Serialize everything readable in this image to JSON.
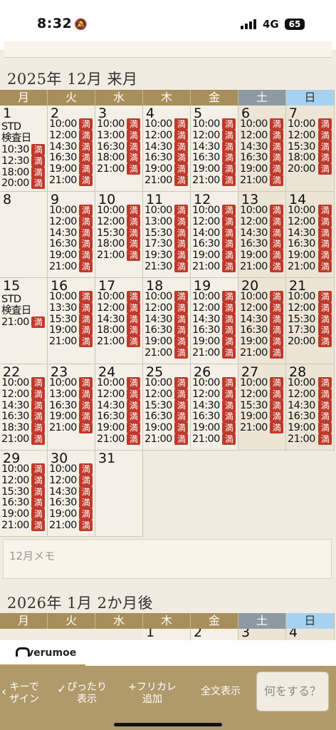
{
  "status": {
    "time": "8:32",
    "network": "4G",
    "battery": "65"
  },
  "dow": [
    "月",
    "火",
    "水",
    "木",
    "金",
    "土",
    "日"
  ],
  "december": {
    "title": "2025年 12月 来月",
    "full_mark": "満",
    "weeks": [
      [
        {
          "day": "1",
          "notes": [
            "STD",
            "検査日"
          ],
          "slots": [
            "10:30",
            "12:30",
            "18:00",
            "20:00"
          ]
        },
        {
          "day": "2",
          "slots": [
            "10:00",
            "12:00",
            "14:30",
            "16:30",
            "19:00",
            "21:00"
          ]
        },
        {
          "day": "3",
          "slots": [
            "10:00",
            "13:00",
            "16:30",
            "18:00",
            "21:00"
          ]
        },
        {
          "day": "4",
          "slots": [
            "10:00",
            "12:00",
            "14:30",
            "16:30",
            "19:00",
            "21:00"
          ]
        },
        {
          "day": "5",
          "slots": [
            "10:00",
            "12:00",
            "14:30",
            "16:30",
            "19:00",
            "21:00"
          ]
        },
        {
          "day": "6",
          "slots": [
            "10:00",
            "12:00",
            "14:30",
            "16:30",
            "19:00",
            "21:00"
          ]
        },
        {
          "day": "7",
          "slots": [
            "10:00",
            "12:00",
            "15:30",
            "18:00",
            "20:00"
          ]
        }
      ],
      [
        {
          "day": "8",
          "slots": []
        },
        {
          "day": "9",
          "slots": [
            "10:00",
            "12:00",
            "14:30",
            "16:30",
            "19:00",
            "21:00"
          ]
        },
        {
          "day": "10",
          "slots": [
            "10:00",
            "12:00",
            "15:30",
            "18:00",
            "21:00"
          ]
        },
        {
          "day": "11",
          "slots": [
            "10:00",
            "13:00",
            "15:30",
            "17:30",
            "19:30",
            "21:30"
          ]
        },
        {
          "day": "12",
          "slots": [
            "10:00",
            "12:00",
            "14:00",
            "16:30",
            "19:00",
            "21:00"
          ]
        },
        {
          "day": "13",
          "slots": [
            "10:00",
            "12:00",
            "14:30",
            "16:30",
            "19:00",
            "21:00"
          ]
        },
        {
          "day": "14",
          "slots": [
            "10:00",
            "12:00",
            "14:30",
            "16:30",
            "19:00",
            "21:00"
          ]
        }
      ],
      [
        {
          "day": "15",
          "notes": [
            "STD",
            "検査日"
          ],
          "slots": [
            "21:00"
          ]
        },
        {
          "day": "16",
          "slots": [
            "10:00",
            "13:30",
            "15:30",
            "19:00",
            "21:00"
          ]
        },
        {
          "day": "17",
          "slots": [
            "10:00",
            "12:00",
            "14:30",
            "18:00",
            "21:00"
          ]
        },
        {
          "day": "18",
          "slots": [
            "10:00",
            "12:00",
            "14:30",
            "16:30",
            "19:00",
            "21:00"
          ]
        },
        {
          "day": "19",
          "slots": [
            "10:00",
            "12:00",
            "14:30",
            "16:30",
            "19:00",
            "21:00"
          ]
        },
        {
          "day": "20",
          "slots": [
            "10:00",
            "12:00",
            "14:30",
            "16:30",
            "19:00",
            "21:00"
          ]
        },
        {
          "day": "21",
          "slots": [
            "10:00",
            "12:00",
            "15:30",
            "17:30",
            "20:00"
          ]
        }
      ],
      [
        {
          "day": "22",
          "slots": [
            "10:00",
            "12:00",
            "14:30",
            "16:30",
            "18:30",
            "21:00"
          ]
        },
        {
          "day": "23",
          "slots": [
            "10:00",
            "13:00",
            "16:30",
            "19:00",
            "21:00"
          ]
        },
        {
          "day": "24",
          "slots": [
            "10:00",
            "12:00",
            "14:30",
            "16:30",
            "19:00",
            "21:00"
          ]
        },
        {
          "day": "25",
          "slots": [
            "10:00",
            "12:00",
            "15:30",
            "16:30",
            "19:00",
            "21:00"
          ]
        },
        {
          "day": "26",
          "slots": [
            "10:00",
            "12:00",
            "14:30",
            "16:30",
            "19:00",
            "21:00"
          ]
        },
        {
          "day": "27",
          "slots": [
            "10:00",
            "12:00",
            "15:30",
            "19:00",
            "21:00"
          ]
        },
        {
          "day": "28",
          "slots": [
            "10:00",
            "12:00",
            "14:30",
            "16:30",
            "19:00",
            "21:00"
          ]
        }
      ],
      [
        {
          "day": "29",
          "slots": [
            "10:00",
            "12:00",
            "15:30",
            "16:30",
            "19:00",
            "21:00"
          ]
        },
        {
          "day": "30",
          "slots": [
            "10:00",
            "12:00",
            "14:30",
            "16:30",
            "19:00",
            "21:00"
          ]
        },
        {
          "day": "31",
          "slots": []
        }
      ]
    ],
    "memo_placeholder": "12月メモ"
  },
  "january": {
    "title": "2026年 1月 2か月後",
    "first_days": [
      "1",
      "2",
      "3",
      "4"
    ]
  },
  "brand": "verumoe",
  "toolbar": {
    "key_label": "キーで\nザイン",
    "fit_label": "ぴったり\n表示",
    "furigana_label": "+フリカレ\n追加",
    "fulltext_label": "全文表示",
    "ask_label": "何をする？"
  },
  "colors": {
    "header": "#a88e5a",
    "saturday": "#8d9aa3",
    "sunday": "#a6d2ef",
    "full_badge": "#c0392b"
  }
}
